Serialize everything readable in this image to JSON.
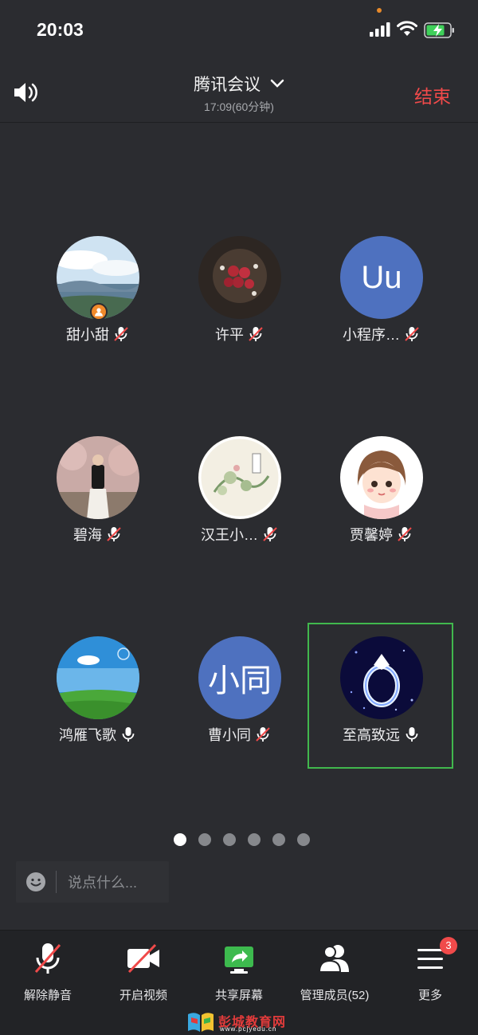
{
  "status": {
    "time": "20:03"
  },
  "header": {
    "title": "腾讯会议",
    "subtitle": "17:09(60分钟)",
    "end_label": "结束"
  },
  "participants": [
    {
      "name": "甜小甜",
      "avatar": "landscape-photo",
      "mic": "muted",
      "host": true
    },
    {
      "name": "许平",
      "avatar": "rose-bouquet-photo",
      "mic": "muted"
    },
    {
      "name": "小程序…",
      "avatar_text": "Uu",
      "mic": "muted"
    },
    {
      "name": "碧海",
      "avatar": "woman-blossoms-photo",
      "mic": "muted"
    },
    {
      "name": "汉王小…",
      "avatar": "ink-painting-photo",
      "mic": "muted"
    },
    {
      "name": "贾馨婷",
      "avatar": "cartoon-girl-photo",
      "mic": "muted"
    },
    {
      "name": "鸿雁飞歌",
      "avatar": "blue-sky-meadow-photo",
      "mic": "on"
    },
    {
      "name": "曹小同",
      "avatar_text": "小同",
      "mic": "muted"
    },
    {
      "name": "至高致远",
      "avatar": "diamond-ring-photo",
      "mic": "on",
      "speaking": true
    }
  ],
  "pagination": {
    "pages": 6,
    "current": 1
  },
  "chat": {
    "placeholder": "说点什么..."
  },
  "toolbar": {
    "unmute": "解除静音",
    "video": "开启视频",
    "share": "共享屏幕",
    "members": "管理成员(52)",
    "more": "更多",
    "more_badge": "3"
  },
  "watermark": {
    "text": "彭城教育网",
    "url": "www.pcjyedu.cn"
  },
  "colors": {
    "end": "#f04a4a",
    "speaking_border": "#41b84d",
    "share_icon": "#3dba4e",
    "avatar_blue": "#4e71bf"
  }
}
